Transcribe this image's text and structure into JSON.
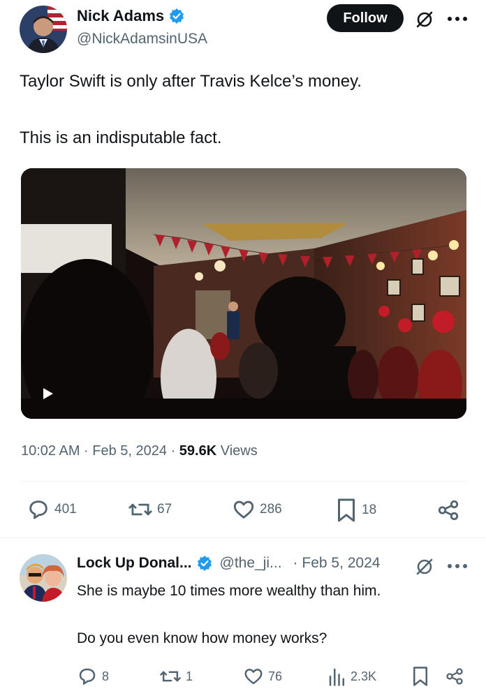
{
  "tweet": {
    "author_name": "Nick Adams",
    "author_handle": "@NickAdamsinUSA",
    "follow_label": "Follow",
    "text_line1": "Taylor Swift is only after Travis Kelce’s money.",
    "text_line2": "This is an indisputable fact.",
    "timestamp": "10:02 AM · Feb 5, 2024 · ",
    "views_count": "59.6K",
    "views_label": " Views",
    "replies": "401",
    "reposts": "67",
    "likes": "286",
    "bookmarks": "18"
  },
  "reply": {
    "author_name": "Lock Up Donal...",
    "author_handle": "@the_ji...",
    "date": "· Feb 5, 2024",
    "text_line1": "She is maybe 10 times more wealthy than him.",
    "text_line2": "Do you even know how money works?",
    "replies": "8",
    "reposts": "1",
    "likes": "76",
    "views": "2.3K"
  },
  "icons": {
    "verified": "verified-badge-icon",
    "grok": "grok-icon",
    "more": "more-icon",
    "play": "play-icon",
    "reply": "reply-icon",
    "repost": "repost-icon",
    "like": "like-icon",
    "bookmark": "bookmark-icon",
    "share": "share-icon",
    "analytics": "analytics-icon"
  },
  "colors": {
    "verified_blue": "#1d9bf0",
    "text_primary": "#0f1419",
    "text_secondary": "#536471"
  }
}
